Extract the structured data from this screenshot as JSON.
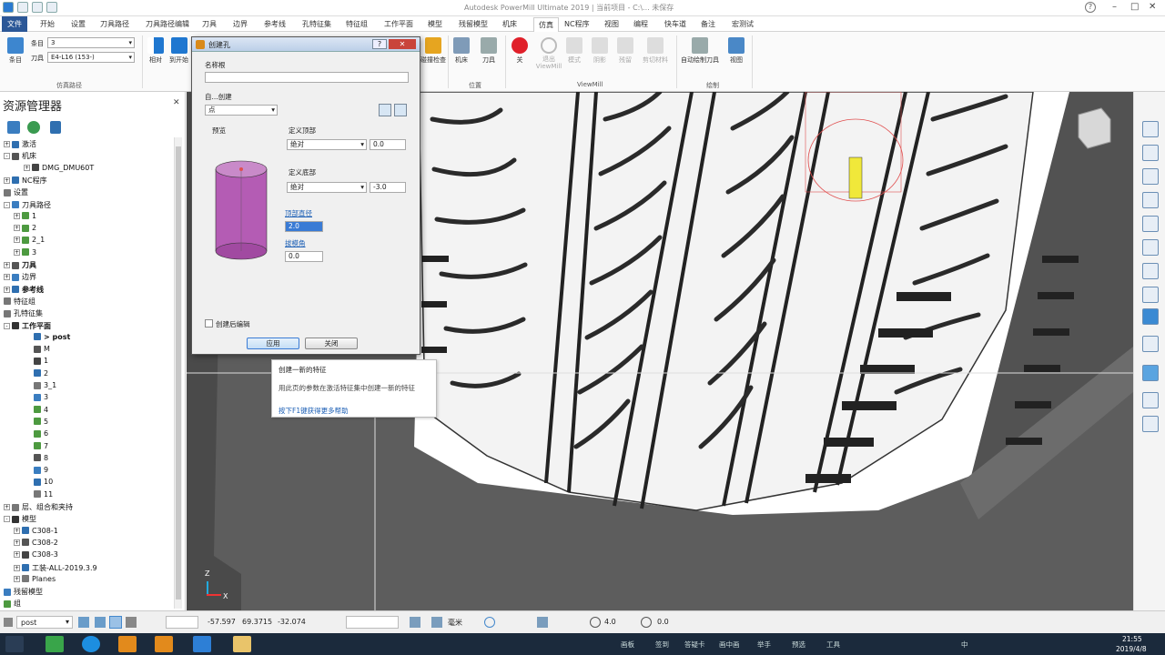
{
  "titlebar": {
    "title": "Autodesk PowerMill Ultimate 2019 | 当前项目 - C:\\... 未保存"
  },
  "menus": [
    "开始",
    "设置",
    "刀具路径",
    "刀具路径编辑",
    "刀具",
    "边界",
    "参考线",
    "孔特征集",
    "特征组",
    "工作平面",
    "模型",
    "残留模型",
    "机床",
    "仿真",
    "NC程序",
    "视图",
    "编程",
    "快车道",
    "备注",
    "宏测试"
  ],
  "menu_file": "文件",
  "active_menu": "仿真",
  "ribbon": {
    "item_label": "条目",
    "item_value": "3",
    "tool_label": "刀具",
    "tool_value": "E4-L16 (153-)",
    "group_sim_path": "仿真路径",
    "btn_relative": "相对",
    "btn_to_start": "到开始",
    "btn_collision": "碰撞检查",
    "btn_machine": "机床",
    "btn_tool": "刀具",
    "group_position": "位置",
    "btn_off": "关",
    "btn_exit": "退出ViewMill",
    "btn_mode": "模式",
    "btn_colour": "阴影",
    "btn_rest": "残留",
    "btn_cut": "剪切材料",
    "group_viewmill": "ViewMill",
    "btn_auto_tool": "自动绘制刀具",
    "btn_view": "视图",
    "group_draw": "绘制"
  },
  "explorer": {
    "title": "资源管理器",
    "tree": [
      {
        "text": "激活",
        "indent": 0,
        "expand": "+",
        "bold": false
      },
      {
        "text": "机床",
        "indent": 0,
        "expand": "-",
        "bold": false
      },
      {
        "text": "DMG_DMU60T",
        "indent": 2,
        "expand": "+",
        "bold": false
      },
      {
        "text": "NC程序",
        "indent": 0,
        "expand": "+",
        "bold": false
      },
      {
        "text": "设置",
        "indent": 0,
        "expand": "",
        "bold": false
      },
      {
        "text": "刀具路径",
        "indent": 0,
        "expand": "-",
        "bold": false
      },
      {
        "text": "1",
        "indent": 1,
        "expand": "+",
        "bold": false
      },
      {
        "text": "2",
        "indent": 1,
        "expand": "+",
        "bold": false
      },
      {
        "text": "2_1",
        "indent": 1,
        "expand": "+",
        "bold": false
      },
      {
        "text": "3",
        "indent": 1,
        "expand": "+",
        "bold": false
      },
      {
        "text": "刀具",
        "indent": 0,
        "expand": "+",
        "bold": true
      },
      {
        "text": "边界",
        "indent": 0,
        "expand": "+",
        "bold": false
      },
      {
        "text": "参考线",
        "indent": 0,
        "expand": "+",
        "bold": true
      },
      {
        "text": "特征组",
        "indent": 0,
        "expand": "",
        "bold": false
      },
      {
        "text": "孔特征集",
        "indent": 0,
        "expand": "",
        "bold": false
      },
      {
        "text": "工作平面",
        "indent": 0,
        "expand": "-",
        "bold": true
      },
      {
        "text": "> post",
        "indent": 3,
        "expand": "",
        "bold": true
      },
      {
        "text": "M",
        "indent": 3,
        "expand": "",
        "bold": false
      },
      {
        "text": "1",
        "indent": 3,
        "expand": "",
        "bold": false
      },
      {
        "text": "2",
        "indent": 3,
        "expand": "",
        "bold": false
      },
      {
        "text": "3_1",
        "indent": 3,
        "expand": "",
        "bold": false
      },
      {
        "text": "3",
        "indent": 3,
        "expand": "",
        "bold": false
      },
      {
        "text": "4",
        "indent": 3,
        "expand": "",
        "bold": false
      },
      {
        "text": "5",
        "indent": 3,
        "expand": "",
        "bold": false
      },
      {
        "text": "6",
        "indent": 3,
        "expand": "",
        "bold": false
      },
      {
        "text": "7",
        "indent": 3,
        "expand": "",
        "bold": false
      },
      {
        "text": "8",
        "indent": 3,
        "expand": "",
        "bold": false
      },
      {
        "text": "9",
        "indent": 3,
        "expand": "",
        "bold": false
      },
      {
        "text": "10",
        "indent": 3,
        "expand": "",
        "bold": false
      },
      {
        "text": "11",
        "indent": 3,
        "expand": "",
        "bold": false
      },
      {
        "text": "层、组合和夹持",
        "indent": 0,
        "expand": "+",
        "bold": false
      },
      {
        "text": "模型",
        "indent": 0,
        "expand": "-",
        "bold": false
      },
      {
        "text": "C308-1",
        "indent": 1,
        "expand": "+",
        "bold": false
      },
      {
        "text": "C308-2",
        "indent": 1,
        "expand": "+",
        "bold": false
      },
      {
        "text": "C308-3",
        "indent": 1,
        "expand": "+",
        "bold": false
      },
      {
        "text": "工装-ALL-2019.3.9",
        "indent": 1,
        "expand": "+",
        "bold": false
      },
      {
        "text": "Planes",
        "indent": 1,
        "expand": "+",
        "bold": false
      },
      {
        "text": "残留模型",
        "indent": 0,
        "expand": "",
        "bold": false
      },
      {
        "text": "组",
        "indent": 0,
        "expand": "",
        "bold": false
      }
    ]
  },
  "dialog": {
    "title": "创建孔",
    "name_root_label": "名称根",
    "name_root_value": "",
    "from_label": "自...创建",
    "from_value": "点",
    "preview_label": "预览",
    "top_label": "定义顶部",
    "top_mode": "绝对",
    "top_value": "0.0",
    "bottom_label": "定义底部",
    "bottom_mode": "绝对",
    "bottom_value": "-3.0",
    "top_diameter_label": "顶部直径",
    "top_diameter_value": "2.0",
    "draft_label": "拔模角",
    "draft_value": "0.0",
    "edit_after_label": "创建后编辑",
    "apply_label": "应用",
    "close_label": "关闭"
  },
  "tooltip": {
    "line1": "创建一新的特征",
    "line2": "用此页的参数在激活特征集中创建一新的特征",
    "line3": "按下F1键获得更多帮助"
  },
  "axis": {
    "z": "Z",
    "x": "X"
  },
  "statusbar": {
    "workplane": "post",
    "x": "-57.597",
    "y": "69.3715",
    "z": "-32.074",
    "unit": "毫米",
    "tol1": "4.0",
    "tol2": "0.0"
  },
  "taskbar": {
    "labels": [
      "画板",
      "签到",
      "答疑卡",
      "画中画",
      "举手",
      "预选",
      "工具"
    ],
    "time": "21:55",
    "date": "2019/4/8",
    "lang": "中"
  },
  "colors": {
    "accent": "#2b5797",
    "preview": "#b45cb4",
    "tool_highlight": "#e8e23a"
  }
}
